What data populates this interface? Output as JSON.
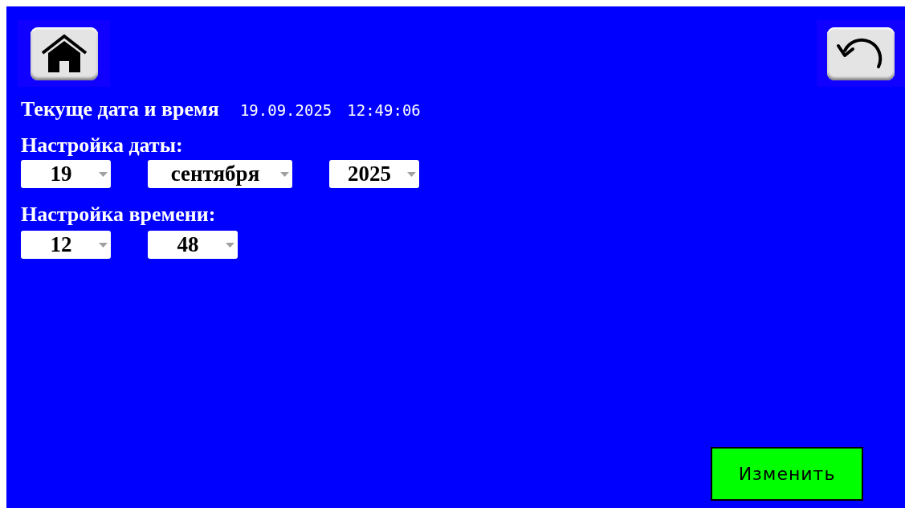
{
  "current": {
    "label": "Текуще дата и время",
    "date": "19.09.2025",
    "time": "12:49:06"
  },
  "date_settings": {
    "label": "Настройка даты:",
    "selects": [
      {
        "value": "19",
        "kind": "number"
      },
      {
        "value": "сентября",
        "kind": "month"
      },
      {
        "value": "2025",
        "kind": "number"
      }
    ]
  },
  "time_settings": {
    "label": "Настройка времени:",
    "selects": [
      {
        "value": "12",
        "kind": "number"
      },
      {
        "value": "48",
        "kind": "number"
      }
    ]
  },
  "apply_button": "Изменить"
}
